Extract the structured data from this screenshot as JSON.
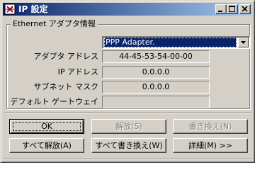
{
  "window": {
    "title": "IP 設定",
    "controls": {
      "minimize": "minimize",
      "maximize": "maximize",
      "close": "close"
    }
  },
  "adapter_group": {
    "legend": "Ethernet  アダプタ情報",
    "adapter_select": {
      "selected": "PPP Adapter."
    },
    "fields": [
      {
        "label": "アダプタ アドレス",
        "value": "44-45-53-54-00-00"
      },
      {
        "label": "IP アドレス",
        "value": "0.0.0.0"
      },
      {
        "label": "サブネット マスク",
        "value": "0.0.0.0"
      },
      {
        "label": "デフォルト ゲートウェイ",
        "value": ""
      }
    ]
  },
  "buttons": {
    "ok": "OK",
    "release": "解放(S)",
    "renew": "書き換え(N)",
    "release_all": "すべて解放(A)",
    "renew_all": "すべて書き換え(W)",
    "details": "詳細(M) >>"
  },
  "colors": {
    "face": "#d4d0c8",
    "title_start": "#0a246a",
    "title_end": "#a6caf0",
    "selection": "#0a246a",
    "disabled_text": "#808080"
  },
  "icons": {
    "app": "network-app-icon",
    "dropdown": "chevron-down-icon"
  }
}
